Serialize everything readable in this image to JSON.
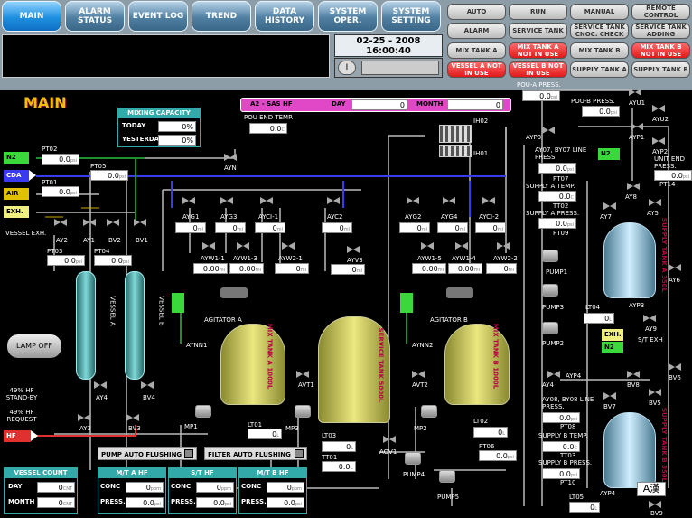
{
  "tabs": {
    "main": "MAIN",
    "alarm": "ALARM STATUS",
    "event": "EVENT LOG",
    "trend": "TREND",
    "data": "DATA HISTORY",
    "sysop": "SYSTEM OPER.",
    "sysset": "SYSTEM SETTING"
  },
  "sbtns": {
    "auto": "AUTO",
    "run": "RUN",
    "manual": "MANUAL",
    "remote": "REMOTE CONTROL",
    "alarm": "ALARM",
    "service": "SERVICE TANK",
    "stcheck": "SERVICE TANK CNOC. CHECK",
    "stadd": "SERVICE TANK ADDING",
    "mixa": "MIX TANK A",
    "mixa_nu": "MIX TANK A NOT IN USE",
    "mixb": "MIX TANK B",
    "mixb_nu": "MIX TANK B NOT IN USE",
    "vessela": "VESSEL A NOT IN USE",
    "vesselb": "VESSEL B NOT IN USE",
    "supa": "SUPPLY TANK A",
    "supb": "SUPPLY TANK B"
  },
  "clock": {
    "date": "02-25 - 2008",
    "time": "16:00:40",
    "icon": "I"
  },
  "title": "MAIN",
  "mixcap": {
    "title": "MIXING CAPACITY",
    "today": "TODAY",
    "yesterday": "YESTERDAY",
    "v1": "0%",
    "v2": "0%"
  },
  "recipe": {
    "name": "A2 - SAS HF",
    "day": "DAY",
    "month": "MONTH",
    "dayv": "0",
    "monthv": "0"
  },
  "tags": {
    "n2": "N2",
    "cda": "CDA",
    "air": "AIR",
    "exh": "EXH.",
    "hf": "HF",
    "exh2": "EXH.",
    "n2b": "N2",
    "n2c": "N2"
  },
  "labels": {
    "pt02": "PT02",
    "pt01": "PT01",
    "pt05": "PT05",
    "pt03": "PT03",
    "pt04": "PT04",
    "vexh": "VESSEL EXH.",
    "aynn": "AYN",
    "pouend": "POU END TEMP.",
    "poua": "POU-A PRESS.",
    "poub": "POU-B PRESS.",
    "ayu1": "AYU1",
    "ayu2": "AYU2",
    "ayp1": "AYP1",
    "ayp2": "AYP2",
    "ayp3": "AYP3",
    "ih02": "IH02",
    "ih01": "IH01",
    "a07": "AY07, BY07 LINE PRESS.",
    "pt07": "PT07",
    "sat": "SUPPLY A TEMP.",
    "tt02": "TT02",
    "sap": "SUPPLY A PRESS.",
    "pt09": "PT09",
    "pump1": "PUMP1",
    "pump2": "PUMP2",
    "pump3": "PUMP3",
    "pump4": "PUMP4",
    "pump5": "PUMP5",
    "lt04": "LT04",
    "ay9": "AY9",
    "stexh": "S/T EXH",
    "ay4": "AY4",
    "bv4": "BV4",
    "ay3": "AY3",
    "bv3": "BV3",
    "lamp": "LAMP OFF",
    "hfsb": "49% HF STAND-BY",
    "hfreq": "49% HF REQUEST",
    "agia": "AGITATOR A",
    "agib": "AGITATOR B",
    "aynn1": "AYNN1",
    "aynn2": "AYNN2",
    "avt1": "AVT1",
    "avt2": "AVT2",
    "mp1": "MP1",
    "mp2": "MP2",
    "mp3": "MP3",
    "lt01": "LT01",
    "lt02": "LT02",
    "lt03": "LT03",
    "tt01": "TT01",
    "tt03": "TT03",
    "aov1": "AOV1",
    "pt06": "PT06",
    "ayp4": "AYP4",
    "aypb": "AYP4",
    "b08": "AY08, BY08 LINE PRESS.",
    "pt08": "PT08",
    "sbt": "SUPPLY B TEMP.",
    "sbp": "SUPPLY B PRESS.",
    "pt10": "PT10",
    "lt05": "LT05",
    "bv9": "BV9",
    "bv5": "BV5",
    "bv6": "BV6",
    "bv7": "BV7",
    "bv8": "BV8",
    "ay5": "AY5",
    "ay6": "AY6",
    "ay7": "AY7",
    "ay8": "AY8",
    "uep": "UNIT END PRESS.",
    "pt14": "PT14",
    "vessela": "VESSEL A",
    "vesselb": "VESSEL B",
    "mixa": "MIX TANK A 1000L",
    "mixb": "MIX TANK B 1000L",
    "service": "SERVICE TANK 5000L",
    "supa": "SUPPLY TANK A 350L",
    "supb": "SUPPLY TANK B 350L",
    "ime": "A漢",
    "ay1": "AY1",
    "ay2": "AY2",
    "av2": "AV2",
    "bv1": "BV1",
    "bv2": "BV2",
    "ayg1": "AYG1",
    "ayg2": "AYG2",
    "ayg3": "AYG3",
    "ayg4": "AYG4",
    "ayc1": "AYCI-1",
    "ayc2": "AYC2",
    "aycl2": "AYCI-2",
    "ayw1": "AYW1-1",
    "ayw13": "AYW1-3",
    "ayw2": "AYW2-1",
    "ayv3": "AYV3",
    "ayw15": "AYW1-5",
    "ayw4": "AYW1-4",
    "ayw22": "AYW2-2"
  },
  "vals": {
    "pt02": "0.0",
    "pt01": "0.0",
    "pt05": "0.0",
    "pt03": "0.0",
    "pt04": "0.0",
    "pouend": "0.0",
    "poua": "0.0",
    "poub": "0.0",
    "pt07": "0.0",
    "tt02": "0.0",
    "pt09": "0.0",
    "lt04": "0",
    "pt14": "0.0",
    "lt01": "0",
    "lt02": "0",
    "lt03": "0",
    "tt01": "0.0",
    "tt03": "0.0",
    "pt06": "0.0",
    "pt08": "0.0",
    "pt10": "0.0",
    "lt05": "0",
    "ayg1": "0",
    "ayg2": "0",
    "aycl1": "0",
    "ayc2": "0",
    "ayg3": "0",
    "ayg4": "0",
    "aycl2": "0",
    "ayw11": "0.00",
    "ayw13": "0.00",
    "ayw21": "0",
    "ayv3": "0",
    "ayw15": "0.00",
    "ayw14": "0.00",
    "ayw22": "0"
  },
  "units": {
    "psi": "psi",
    "c": "C",
    "l": "L",
    "ml": "ml",
    "pct": "%",
    "ppm": "ppm",
    "cnt": "CNT"
  },
  "flush": {
    "pump": "PUMP AUTO FLUSHING",
    "filter": "FILTER AUTO FLUSHING"
  },
  "vcount": {
    "title": "VESSEL COUNT",
    "day": "DAY",
    "month": "MONTH",
    "d": "0",
    "m": "0"
  },
  "mta": {
    "title": "M/T A HF",
    "conc": "CONC",
    "press": "PRESS.",
    "c": "0",
    "p": "0.0"
  },
  "sthf": {
    "title": "S/T HF",
    "conc": "CONC",
    "press": "PRESS.",
    "c": "0",
    "p": "0.0"
  },
  "mtb": {
    "title": "M/T B HF",
    "conc": "CONC",
    "press": "PRESS.",
    "c": "0",
    "p": "0.0"
  }
}
